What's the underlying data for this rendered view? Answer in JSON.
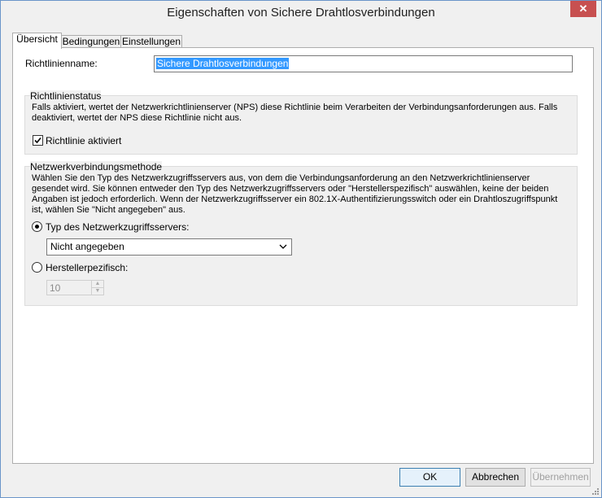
{
  "window": {
    "title": "Eigenschaften von Sichere Drahtlosverbindungen",
    "close_glyph": "✕"
  },
  "tabs": [
    {
      "label": "Übersicht",
      "active": true
    },
    {
      "label": "Bedingungen",
      "active": false
    },
    {
      "label": "Einstellungen",
      "active": false
    }
  ],
  "policy_name": {
    "label": "Richtlinienname:",
    "value": "Sichere Drahtlosverbindungen"
  },
  "policy_status": {
    "title": "Richtlinienstatus",
    "description": "Falls aktiviert, wertet der Netzwerkrichtlinienserver (NPS) diese Richtlinie beim Verarbeiten der Verbindungsanforderungen aus. Falls deaktiviert, wertet der NPS diese Richtlinie nicht aus.",
    "enabled_label": "Richtlinie aktiviert",
    "enabled": true
  },
  "connection_method": {
    "title": "Netzwerkverbindungsmethode",
    "description": "Wählen Sie den Typ des Netzwerkzugriffsservers aus, von dem die Verbindungsanforderung an den Netzwerkrichtlinienserver gesendet wird. Sie können entweder den Typ des Netzwerkzugriffsservers oder \"Herstellerspezifisch\" auswählen, keine der beiden Angaben ist jedoch erforderlich. Wenn der Netzwerkzugriffsserver ein 802.1X-Authentifizierungsswitch oder ein Drahtloszugriffspunkt ist, wählen Sie \"Nicht angegeben\" aus.",
    "type_radio_label": "Typ des Netzwerkzugriffsservers:",
    "type_selected": true,
    "type_value": "Nicht angegeben",
    "vendor_radio_label": "Herstellerpezifisch:",
    "vendor_selected": false,
    "vendor_value": "10"
  },
  "buttons": {
    "ok": "OK",
    "cancel": "Abbrechen",
    "apply": "Übernehmen"
  },
  "icons": {
    "close": "close-icon",
    "dropdown": "chevron-down-icon",
    "spin_up": "spin-up-icon",
    "spin_down": "spin-down-icon",
    "check": "checkmark-icon"
  }
}
